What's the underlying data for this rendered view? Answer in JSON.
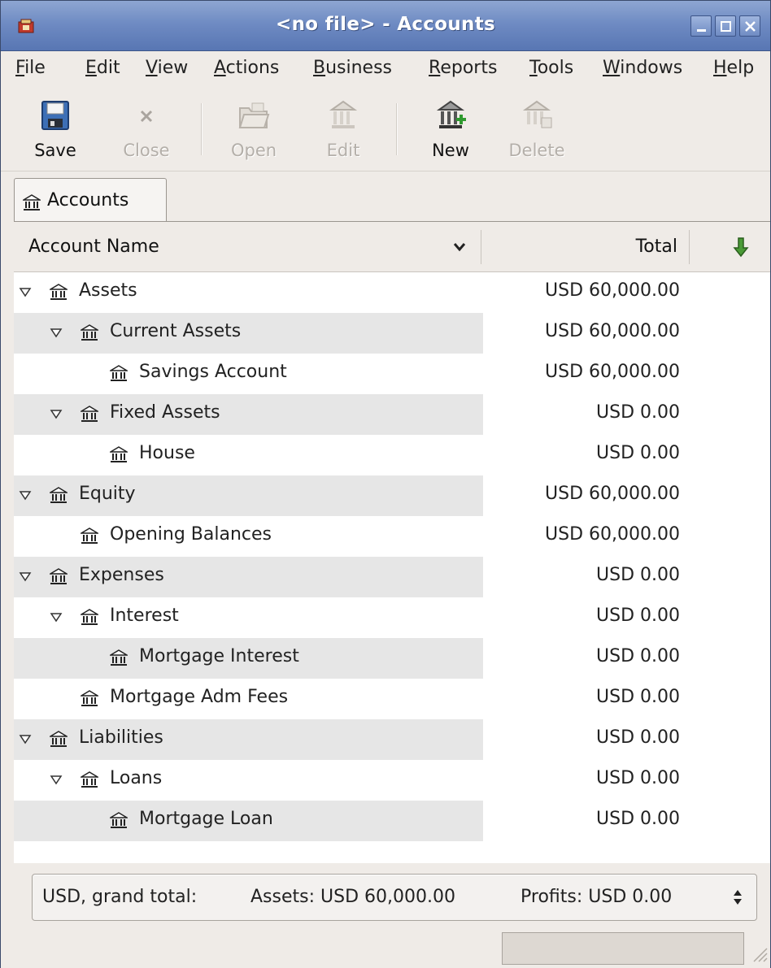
{
  "window": {
    "title": "<no file> - Accounts",
    "controls": [
      "minimize-icon",
      "maximize-icon",
      "close-icon"
    ]
  },
  "menubar": {
    "items": [
      {
        "mnemonic": "F",
        "rest": "ile"
      },
      {
        "mnemonic": "E",
        "rest": "dit"
      },
      {
        "mnemonic": "V",
        "rest": "iew"
      },
      {
        "mnemonic": "A",
        "rest": "ctions"
      },
      {
        "mnemonic": "B",
        "rest": "usiness"
      },
      {
        "mnemonic": "R",
        "rest": "eports"
      },
      {
        "mnemonic": "T",
        "rest": "ools"
      },
      {
        "mnemonic": "W",
        "rest": "indows"
      },
      {
        "mnemonic": "H",
        "rest": "elp"
      }
    ]
  },
  "toolbar": {
    "items": [
      {
        "label": "Save",
        "icon": "floppy-disk-icon",
        "enabled": true
      },
      {
        "label": "Close",
        "icon": "close-x-icon",
        "enabled": false
      },
      {
        "label": "Open",
        "icon": "open-folder-icon",
        "enabled": false
      },
      {
        "label": "Edit",
        "icon": "edit-account-icon",
        "enabled": false
      },
      {
        "label": "New",
        "icon": "new-account-icon",
        "enabled": true
      },
      {
        "label": "Delete",
        "icon": "delete-account-icon",
        "enabled": false
      }
    ]
  },
  "tabs": [
    {
      "label": "Accounts",
      "icon": "bank-icon",
      "active": true
    }
  ],
  "tree": {
    "columns": {
      "name": "Account Name",
      "total": "Total"
    },
    "rows": [
      {
        "name": "Assets",
        "total": "USD 60,000.00",
        "depth": 0,
        "expandable": true
      },
      {
        "name": "Current Assets",
        "total": "USD 60,000.00",
        "depth": 1,
        "expandable": true
      },
      {
        "name": "Savings Account",
        "total": "USD 60,000.00",
        "depth": 2,
        "expandable": false
      },
      {
        "name": "Fixed Assets",
        "total": "USD 0.00",
        "depth": 1,
        "expandable": true
      },
      {
        "name": "House",
        "total": "USD 0.00",
        "depth": 2,
        "expandable": false
      },
      {
        "name": "Equity",
        "total": "USD 60,000.00",
        "depth": 0,
        "expandable": true
      },
      {
        "name": "Opening Balances",
        "total": "USD 60,000.00",
        "depth": 1,
        "expandable": false
      },
      {
        "name": "Expenses",
        "total": "USD 0.00",
        "depth": 0,
        "expandable": true
      },
      {
        "name": "Interest",
        "total": "USD 0.00",
        "depth": 1,
        "expandable": true
      },
      {
        "name": "Mortgage Interest",
        "total": "USD 0.00",
        "depth": 2,
        "expandable": false
      },
      {
        "name": "Mortgage Adm Fees",
        "total": "USD 0.00",
        "depth": 1,
        "expandable": false
      },
      {
        "name": "Liabilities",
        "total": "USD 0.00",
        "depth": 0,
        "expandable": true
      },
      {
        "name": "Loans",
        "total": "USD 0.00",
        "depth": 1,
        "expandable": true
      },
      {
        "name": "Mortgage Loan",
        "total": "USD 0.00",
        "depth": 2,
        "expandable": false
      }
    ]
  },
  "summary": {
    "label": "USD, grand total:",
    "assets": "Assets: USD 60,000.00",
    "profits": "Profits: USD 0.00"
  }
}
